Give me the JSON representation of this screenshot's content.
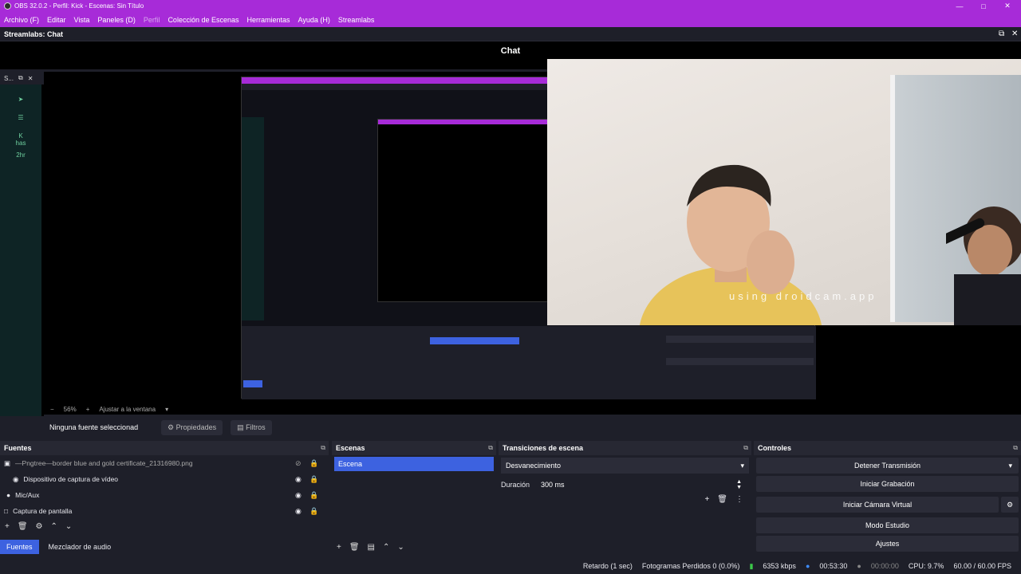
{
  "window": {
    "title": "OBS 32.0.2 - Perfil: Kick - Escenas: Sin Título"
  },
  "menu": {
    "items": [
      "Archivo (F)",
      "Editar",
      "Vista",
      "Paneles (D)",
      "Perfil",
      "Colección de Escenas",
      "Herramientas",
      "Ayuda (H)",
      "Streamlabs"
    ]
  },
  "dock_chat": {
    "title": "Streamlabs: Chat",
    "heading": "Chat"
  },
  "side": {
    "title": "S...",
    "items": [
      "K",
      "has",
      "2hr"
    ]
  },
  "webcam": {
    "watermark": "using droidcam.app"
  },
  "preview": {
    "zoom": "56%",
    "fit": "Ajustar a la ventana"
  },
  "props": {
    "none_selected": "Ninguna fuente seleccionad",
    "properties": "Propiedades",
    "filters": "Filtros"
  },
  "sources": {
    "title": "Fuentes",
    "items": [
      {
        "name": "—Pngtree—border blue and gold certificate_21316980.png",
        "icon": "image-icon"
      },
      {
        "name": "Dispositivo de captura de vídeo",
        "icon": "camera-icon"
      },
      {
        "name": "Mic/Aux",
        "icon": "mic-icon"
      },
      {
        "name": "Captura de pantalla",
        "icon": "monitor-icon"
      }
    ]
  },
  "tabs": {
    "sources": "Fuentes",
    "mixer": "Mezclador de audio"
  },
  "scenes": {
    "title": "Escenas",
    "items": [
      "Escena"
    ]
  },
  "transitions": {
    "title": "Transiciones de escena",
    "type": "Desvanecimiento",
    "duration_label": "Duración",
    "duration": "300 ms"
  },
  "controls": {
    "title": "Controles",
    "stop_stream": "Detener Transmisión",
    "start_record": "Iniciar Grabación",
    "virtual_cam": "Iniciar Cámara Virtual",
    "studio_mode": "Modo Estudio",
    "settings": "Ajustes"
  },
  "status": {
    "delay": "Retardo (1 sec)",
    "dropped": "Fotogramas Perdidos 0 (0.0%)",
    "kbps": "6353 kbps",
    "stream_time": "00:53:30",
    "rec_time": "00:00:00",
    "cpu": "CPU: 9.7%",
    "fps": "60.00 / 60.00 FPS"
  },
  "colors": {
    "titlebar": "#a72bd8",
    "accent": "#3d62e0",
    "bg": "#1e1f29"
  }
}
